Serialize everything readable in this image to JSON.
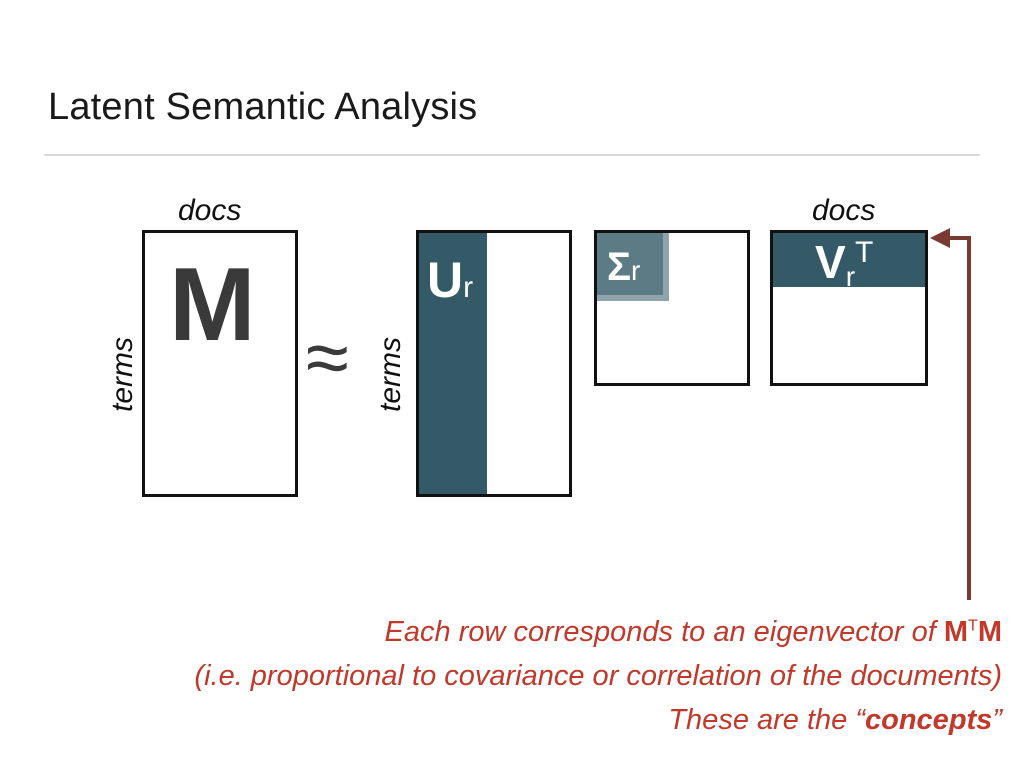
{
  "slide": {
    "title": "Latent Semantic Analysis"
  },
  "diagram": {
    "m_docs_label": "docs",
    "m_terms_label": "terms",
    "m_symbol": "M",
    "approx_symbol": "≈",
    "u_terms_label": "terms",
    "u_symbol": "U",
    "u_subscript": "r",
    "sigma_symbol": "Σ",
    "sigma_subscript": "r",
    "v_docs_label": "docs",
    "v_symbol": "V",
    "v_subscript": "r",
    "v_superscript": "T",
    "fill_color": "#335a66",
    "arrow_color": "#7a3a32"
  },
  "caption": {
    "line1_prefix": "Each row corresponds to an eigenvector of ",
    "line1_m1": "M",
    "line1_sup": "T",
    "line1_m2": "M",
    "line2": "(i.e. proportional to covariance or correlation of the documents)",
    "line3_prefix": "These are the “",
    "line3_bold": "concepts",
    "line3_suffix": "”",
    "color": "#c0392b"
  }
}
